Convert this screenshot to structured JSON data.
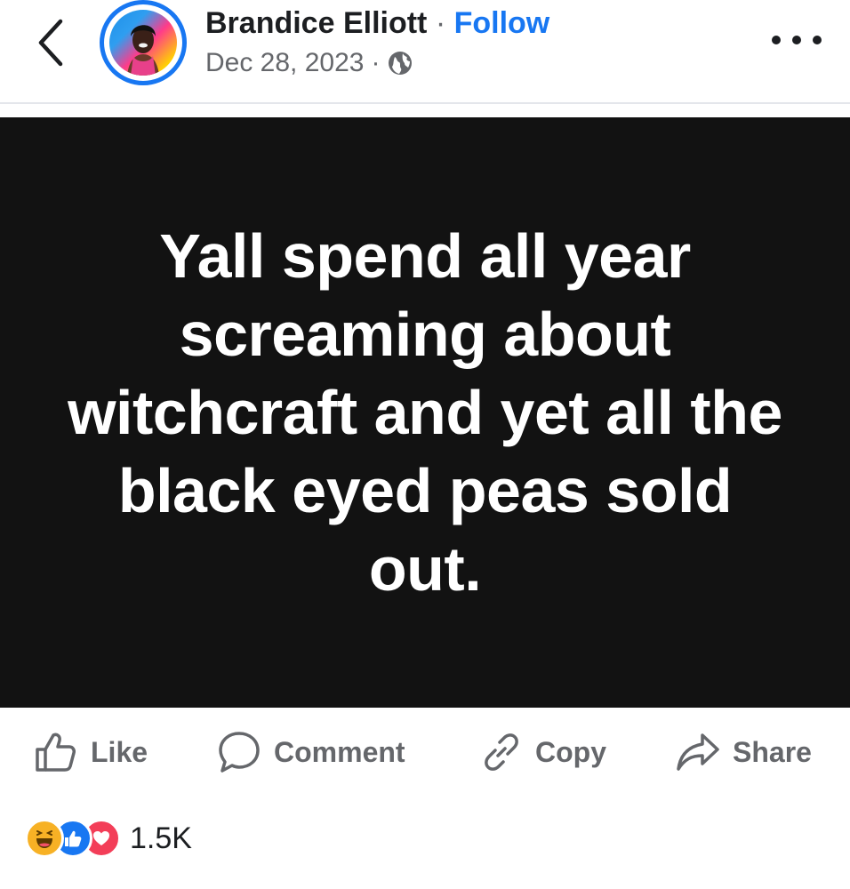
{
  "header": {
    "author": "Brandice Elliott",
    "separator": " · ",
    "follow_label": "Follow",
    "date": "Dec 28, 2023",
    "meta_separator": "·",
    "visibility_icon": "globe-icon",
    "back_icon": "chevron-left-icon",
    "more_icon": "more-horizontal-icon"
  },
  "post": {
    "text": "Yall spend all year screaming about witchcraft and yet all the black eyed peas sold out.",
    "background_color": "#121212"
  },
  "actions": {
    "like_label": "Like",
    "comment_label": "Comment",
    "copy_label": "Copy",
    "share_label": "Share"
  },
  "reactions": {
    "types": [
      "haha",
      "like",
      "love"
    ],
    "count": "1.5K"
  },
  "colors": {
    "accent": "#1877f2",
    "secondary_text": "#65676b",
    "love": "#f33e58",
    "haha": "#f7b125"
  }
}
